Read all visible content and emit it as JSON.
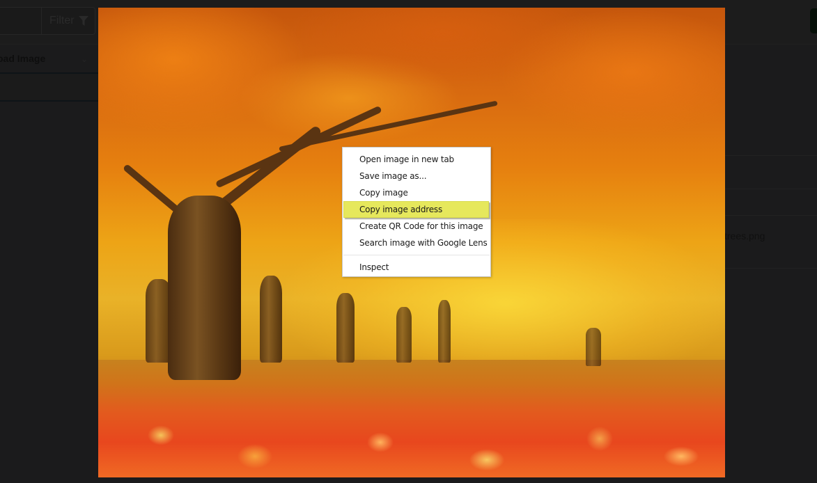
{
  "background_app": {
    "filter_button": {
      "label": "Filter",
      "icon": "filter-funnel-icon"
    },
    "select": {
      "label": "oad Image",
      "icon": "chevron-down-icon"
    },
    "file_name_fragment": "trees.png"
  },
  "lightbox": {
    "image_description": "Autumn park with orange and yellow maple trees and fallen red leaves"
  },
  "context_menu": {
    "items": [
      {
        "label": "Open image in new tab"
      },
      {
        "label": "Save image as..."
      },
      {
        "label": "Copy image"
      },
      {
        "label": "Copy image address",
        "highlighted": true
      },
      {
        "label": "Create QR Code for this image"
      },
      {
        "label": "Search image with Google Lens"
      }
    ],
    "footer_items": [
      {
        "label": "Inspect"
      }
    ],
    "highlight_color": "#e6e85c"
  }
}
